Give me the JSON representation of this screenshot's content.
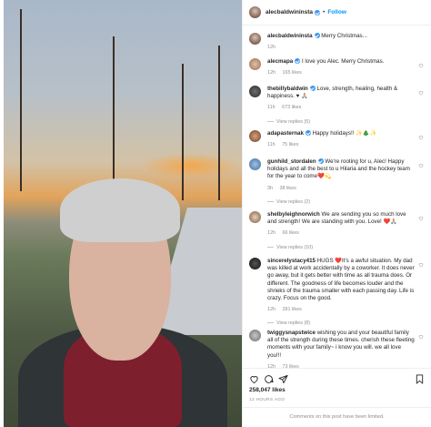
{
  "header": {
    "username": "alecbaldwininsta",
    "separator": "•",
    "follow_label": "Follow"
  },
  "caption": {
    "username": "alecbaldwininsta",
    "text": "Merry Christmas...",
    "time": "12h"
  },
  "comments": [
    {
      "username": "alecmapa",
      "verified": true,
      "text": "I love you Alec. Merry Christmas.",
      "time": "12h",
      "likes": "165 likes",
      "replies": ""
    },
    {
      "username": "thebillybaldwin",
      "verified": true,
      "text": "Love, strength, healing, health & happiness. ♥ 🙏🏼",
      "time": "11h",
      "likes": "673 likes",
      "replies": "View replies (5)"
    },
    {
      "username": "adapasternak",
      "verified": true,
      "text": "Happy holidays!! ✨🎄✨",
      "time": "11h",
      "likes": "75 likes",
      "replies": ""
    },
    {
      "username": "gunhild_stordalen",
      "verified": true,
      "text": "We're rooting for u, Alec! Happy holidays and all the best to u Hilaria and the hockey team for the year to come❤️💫",
      "time": "3h",
      "likes": "38 likes",
      "replies": "View replies (2)"
    },
    {
      "username": "shelbyleighnorwich",
      "verified": false,
      "text": "We are sending you so much love and strength! We are standing with you. Love! ❤️🙏🏼",
      "time": "12h",
      "likes": "66 likes",
      "replies": "View replies (10)"
    },
    {
      "username": "sincerelystacy415",
      "verified": false,
      "text": "HUGS ❤️It's a awful situation. My dad was killed at work accidentally by a coworker. It does never go away, but it gets better with time as all trauma does. Or different. The goodness of life becomes louder and the shrieks of the trauma smaller with each passing day. Life is crazy. Focus on the good.",
      "time": "12h",
      "likes": "281 likes",
      "replies": "View replies (8)"
    },
    {
      "username": "twiggysnapstwice",
      "verified": false,
      "text": "wishing you and your beautiful family all of the strength during these times. cherish these fleeting moments with your family~ i know you will. we all love you!!!",
      "time": "12h",
      "likes": "73 likes",
      "replies": ""
    }
  ],
  "footer": {
    "likes_count": "258,047 likes",
    "time_ago": "12 HOURS AGO",
    "limited_notice": "Comments on this post have been limited."
  },
  "icons": {
    "heart": "heart-icon",
    "comment": "comment-icon",
    "share": "share-icon",
    "save": "bookmark-icon"
  },
  "colors": {
    "accent": "#0095f6",
    "verified": "#3897f0",
    "muted": "#8e8e8e"
  }
}
